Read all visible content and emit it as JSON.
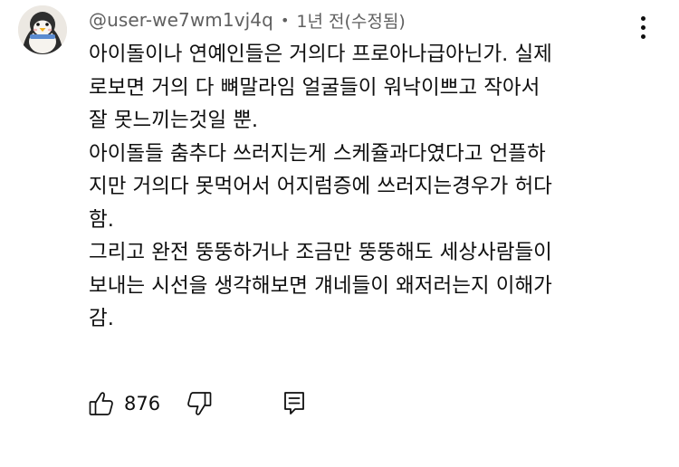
{
  "comment": {
    "author": "@user-we7wm1vj4q",
    "separator": "•",
    "timestamp": "1년 전(수정됨)",
    "lines": [
      "아이돌이나 연예인들은 거의다 프로아나급아닌가. 실제",
      "로보면 거의 다 뼈말라임 얼굴들이 워낙이쁘고 작아서",
      "잘 못느끼는것일 뿐.",
      "아이돌들 춤추다 쓰러지는게 스케쥴과다였다고 언플하",
      "지만 거의다 못먹어서 어지럼증에 쓰러지는경우가 허다",
      "함.",
      "그리고 완전 뚱뚱하거나 조금만 뚱뚱해도 세상사람들이",
      "보내는 시선을 생각해보면 걔네들이 왜저러는지 이해가",
      "감."
    ],
    "like_count": "876"
  },
  "icons": {
    "avatar": "penguin-avatar",
    "menu": "more-vertical-icon",
    "like": "thumbs-up-icon",
    "dislike": "thumbs-down-icon",
    "reply": "reply-comment-icon"
  },
  "colors": {
    "text": "#0f0f0f",
    "secondary_text": "#606060",
    "background": "#ffffff"
  }
}
